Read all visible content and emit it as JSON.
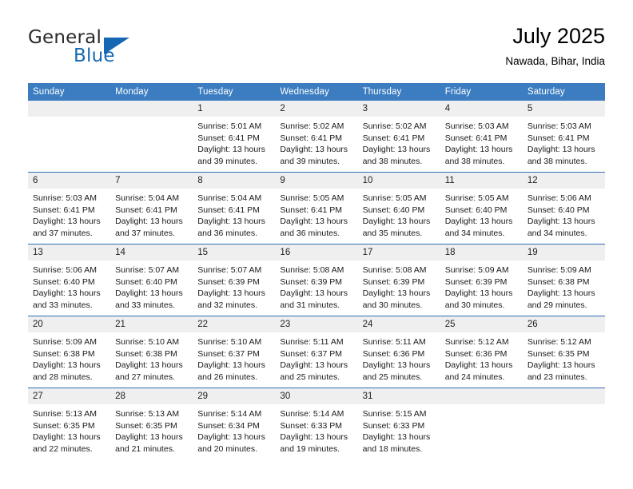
{
  "brand": {
    "word_general": "General",
    "word_blue": "Blue",
    "accent_color": "#1567b3"
  },
  "header": {
    "title": "July 2025",
    "location": "Nawada, Bihar, India"
  },
  "calendar": {
    "header_bg": "#3b7dc0",
    "daynum_bg": "#efefef",
    "row_divider_color": "#2f6fae",
    "weekday_headers": [
      "Sunday",
      "Monday",
      "Tuesday",
      "Wednesday",
      "Thursday",
      "Friday",
      "Saturday"
    ],
    "weeks": [
      [
        {
          "day": "",
          "empty": true
        },
        {
          "day": "",
          "empty": true
        },
        {
          "day": "1",
          "sunrise": "Sunrise: 5:01 AM",
          "sunset": "Sunset: 6:41 PM",
          "daylight": "Daylight: 13 hours and 39 minutes."
        },
        {
          "day": "2",
          "sunrise": "Sunrise: 5:02 AM",
          "sunset": "Sunset: 6:41 PM",
          "daylight": "Daylight: 13 hours and 39 minutes."
        },
        {
          "day": "3",
          "sunrise": "Sunrise: 5:02 AM",
          "sunset": "Sunset: 6:41 PM",
          "daylight": "Daylight: 13 hours and 38 minutes."
        },
        {
          "day": "4",
          "sunrise": "Sunrise: 5:03 AM",
          "sunset": "Sunset: 6:41 PM",
          "daylight": "Daylight: 13 hours and 38 minutes."
        },
        {
          "day": "5",
          "sunrise": "Sunrise: 5:03 AM",
          "sunset": "Sunset: 6:41 PM",
          "daylight": "Daylight: 13 hours and 38 minutes."
        }
      ],
      [
        {
          "day": "6",
          "sunrise": "Sunrise: 5:03 AM",
          "sunset": "Sunset: 6:41 PM",
          "daylight": "Daylight: 13 hours and 37 minutes."
        },
        {
          "day": "7",
          "sunrise": "Sunrise: 5:04 AM",
          "sunset": "Sunset: 6:41 PM",
          "daylight": "Daylight: 13 hours and 37 minutes."
        },
        {
          "day": "8",
          "sunrise": "Sunrise: 5:04 AM",
          "sunset": "Sunset: 6:41 PM",
          "daylight": "Daylight: 13 hours and 36 minutes."
        },
        {
          "day": "9",
          "sunrise": "Sunrise: 5:05 AM",
          "sunset": "Sunset: 6:41 PM",
          "daylight": "Daylight: 13 hours and 36 minutes."
        },
        {
          "day": "10",
          "sunrise": "Sunrise: 5:05 AM",
          "sunset": "Sunset: 6:40 PM",
          "daylight": "Daylight: 13 hours and 35 minutes."
        },
        {
          "day": "11",
          "sunrise": "Sunrise: 5:05 AM",
          "sunset": "Sunset: 6:40 PM",
          "daylight": "Daylight: 13 hours and 34 minutes."
        },
        {
          "day": "12",
          "sunrise": "Sunrise: 5:06 AM",
          "sunset": "Sunset: 6:40 PM",
          "daylight": "Daylight: 13 hours and 34 minutes."
        }
      ],
      [
        {
          "day": "13",
          "sunrise": "Sunrise: 5:06 AM",
          "sunset": "Sunset: 6:40 PM",
          "daylight": "Daylight: 13 hours and 33 minutes."
        },
        {
          "day": "14",
          "sunrise": "Sunrise: 5:07 AM",
          "sunset": "Sunset: 6:40 PM",
          "daylight": "Daylight: 13 hours and 33 minutes."
        },
        {
          "day": "15",
          "sunrise": "Sunrise: 5:07 AM",
          "sunset": "Sunset: 6:39 PM",
          "daylight": "Daylight: 13 hours and 32 minutes."
        },
        {
          "day": "16",
          "sunrise": "Sunrise: 5:08 AM",
          "sunset": "Sunset: 6:39 PM",
          "daylight": "Daylight: 13 hours and 31 minutes."
        },
        {
          "day": "17",
          "sunrise": "Sunrise: 5:08 AM",
          "sunset": "Sunset: 6:39 PM",
          "daylight": "Daylight: 13 hours and 30 minutes."
        },
        {
          "day": "18",
          "sunrise": "Sunrise: 5:09 AM",
          "sunset": "Sunset: 6:39 PM",
          "daylight": "Daylight: 13 hours and 30 minutes."
        },
        {
          "day": "19",
          "sunrise": "Sunrise: 5:09 AM",
          "sunset": "Sunset: 6:38 PM",
          "daylight": "Daylight: 13 hours and 29 minutes."
        }
      ],
      [
        {
          "day": "20",
          "sunrise": "Sunrise: 5:09 AM",
          "sunset": "Sunset: 6:38 PM",
          "daylight": "Daylight: 13 hours and 28 minutes."
        },
        {
          "day": "21",
          "sunrise": "Sunrise: 5:10 AM",
          "sunset": "Sunset: 6:38 PM",
          "daylight": "Daylight: 13 hours and 27 minutes."
        },
        {
          "day": "22",
          "sunrise": "Sunrise: 5:10 AM",
          "sunset": "Sunset: 6:37 PM",
          "daylight": "Daylight: 13 hours and 26 minutes."
        },
        {
          "day": "23",
          "sunrise": "Sunrise: 5:11 AM",
          "sunset": "Sunset: 6:37 PM",
          "daylight": "Daylight: 13 hours and 25 minutes."
        },
        {
          "day": "24",
          "sunrise": "Sunrise: 5:11 AM",
          "sunset": "Sunset: 6:36 PM",
          "daylight": "Daylight: 13 hours and 25 minutes."
        },
        {
          "day": "25",
          "sunrise": "Sunrise: 5:12 AM",
          "sunset": "Sunset: 6:36 PM",
          "daylight": "Daylight: 13 hours and 24 minutes."
        },
        {
          "day": "26",
          "sunrise": "Sunrise: 5:12 AM",
          "sunset": "Sunset: 6:35 PM",
          "daylight": "Daylight: 13 hours and 23 minutes."
        }
      ],
      [
        {
          "day": "27",
          "sunrise": "Sunrise: 5:13 AM",
          "sunset": "Sunset: 6:35 PM",
          "daylight": "Daylight: 13 hours and 22 minutes."
        },
        {
          "day": "28",
          "sunrise": "Sunrise: 5:13 AM",
          "sunset": "Sunset: 6:35 PM",
          "daylight": "Daylight: 13 hours and 21 minutes."
        },
        {
          "day": "29",
          "sunrise": "Sunrise: 5:14 AM",
          "sunset": "Sunset: 6:34 PM",
          "daylight": "Daylight: 13 hours and 20 minutes."
        },
        {
          "day": "30",
          "sunrise": "Sunrise: 5:14 AM",
          "sunset": "Sunset: 6:33 PM",
          "daylight": "Daylight: 13 hours and 19 minutes."
        },
        {
          "day": "31",
          "sunrise": "Sunrise: 5:15 AM",
          "sunset": "Sunset: 6:33 PM",
          "daylight": "Daylight: 13 hours and 18 minutes."
        },
        {
          "day": "",
          "empty": true
        },
        {
          "day": "",
          "empty": true
        }
      ]
    ]
  }
}
